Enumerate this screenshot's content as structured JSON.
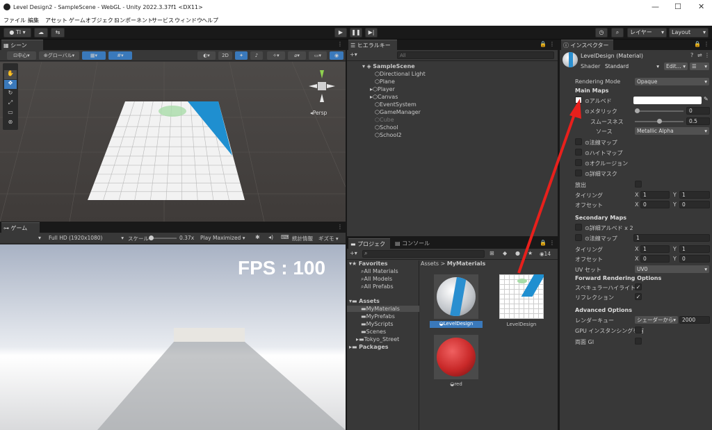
{
  "window": {
    "title": "Level Design2 - SampleScene - WebGL - Unity 2022.3.37f1 <DX11>",
    "minimize": "—",
    "maximize": "☐",
    "close": "✕"
  },
  "menu": [
    "ファイル",
    "編集",
    "アセット",
    "ゲームオブジェクト",
    "コンポーネント",
    "サービス",
    "ウィンドウ",
    "ヘルプ"
  ],
  "toolbar": {
    "account": "TI",
    "layers": "レイヤー",
    "layout": "Layout"
  },
  "scene": {
    "tab": "シーン",
    "pivot": "中心",
    "space": "グローバル",
    "mode2d": "2D",
    "persp": "◂Persp"
  },
  "game": {
    "tab": "ゲーム",
    "resolution": "Full HD (1920x1080)",
    "scale_label": "スケール",
    "scale_value": "0.37x",
    "play_mode": "Play Maximized",
    "stats": "統計情報",
    "gizmos": "ギズモ",
    "fps": "FPS : 100"
  },
  "hierarchy": {
    "tab": "ヒエラルキー",
    "search_placeholder": "All",
    "scene": "SampleScene",
    "items": [
      "Directional Light",
      "Plane",
      "Player",
      "Canvas",
      "EventSystem",
      "GameManager",
      "Cube",
      "School",
      "School2"
    ]
  },
  "project": {
    "tab": "プロジェクト",
    "console_tab": "コンソール",
    "badge": "14",
    "favorites_label": "Favorites",
    "favorites": [
      "All Materials",
      "All Models",
      "All Prefabs"
    ],
    "assets_label": "Assets",
    "asset_folders": [
      "MyMaterials",
      "MyPrefabs",
      "MyScripts",
      "Scenes",
      "Tokyo_Street"
    ],
    "packages_label": "Packages",
    "breadcrumb_root": "Assets",
    "breadcrumb_current": "MyMaterials",
    "assets": [
      "LevelDesign",
      "LevelDesign",
      "red"
    ]
  },
  "inspector": {
    "tab": "インスペクター",
    "name": "LevelDesign (Material)",
    "shader_label": "Shader",
    "shader_value": "Standard",
    "edit_button": "Edit...",
    "rendering_mode_label": "Rendering Mode",
    "rendering_mode_value": "Opaque",
    "main_maps": "Main Maps",
    "albedo": "⊙アルベド",
    "metallic": "⊙メタリック",
    "metallic_value": "0",
    "metallic_level": 0.0,
    "smoothness": "スムースネス",
    "smoothness_value": "0.5",
    "smoothness_level": 0.5,
    "source": "ソース",
    "source_value": "Metallic Alpha",
    "normal_map": "⊙法線マップ",
    "height_map": "⊙ハイトマップ",
    "occlusion": "⊙オクルージョン",
    "detail_mask": "⊙詳細マスク",
    "emission": "放出",
    "tiling": "タイリング",
    "offset": "オフセット",
    "x": "X",
    "y": "Y",
    "tiling_x": "1",
    "tiling_y": "1",
    "offset_x": "0",
    "offset_y": "0",
    "secondary_maps": "Secondary Maps",
    "detail_albedo": "⊙詳細アルベド x 2",
    "sec_normal": "⊙法線マップ",
    "sec_normal_value": "1",
    "sec_tiling_x": "1",
    "sec_tiling_y": "1",
    "sec_offset_x": "0",
    "sec_offset_y": "0",
    "uv_set": "UV セット",
    "uv_set_value": "UV0",
    "forward_options": "Forward Rendering Options",
    "specular": "スペキュラーハイライト",
    "reflections": "リフレクション",
    "advanced": "Advanced Options",
    "render_queue": "レンダーキュー",
    "render_queue_mode": "シェーダーから",
    "render_queue_value": "2000",
    "gpu_instancing": "GPU インスタンシングを有",
    "double_gi": "両面 GI"
  },
  "colors": {
    "accent": "#3a79bb",
    "arrow": "#e8201c",
    "panel": "#383838",
    "dark": "#191919"
  }
}
